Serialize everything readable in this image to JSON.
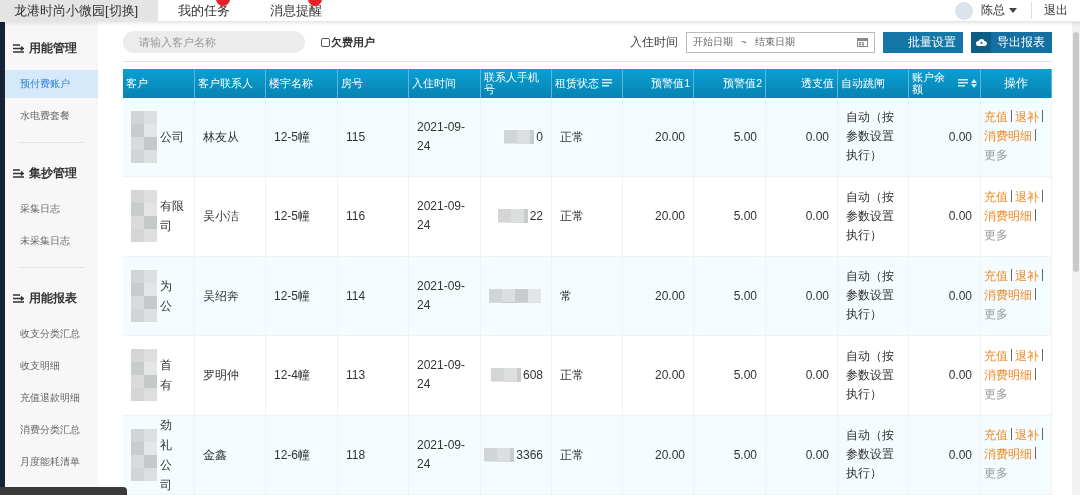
{
  "topbar": {
    "tabs": [
      {
        "label": "龙港时尚小微园[切换]",
        "selected": true,
        "badge": false
      },
      {
        "label": "我的任务",
        "selected": false,
        "badge": true
      },
      {
        "label": "消息提醒",
        "selected": false,
        "badge": true
      }
    ],
    "user": "陈总",
    "logout": "退出"
  },
  "sidebar": [
    {
      "title": "用能管理",
      "items": [
        {
          "label": "预付费账户",
          "selected": true
        },
        {
          "label": "水电费套餐",
          "selected": false
        }
      ]
    },
    {
      "title": "集抄管理",
      "items": [
        {
          "label": "采集日志",
          "selected": false
        },
        {
          "label": "未采集日志",
          "selected": false
        }
      ]
    },
    {
      "title": "用能报表",
      "items": [
        {
          "label": "收支分类汇总",
          "selected": false
        },
        {
          "label": "收支明细",
          "selected": false
        },
        {
          "label": "充值退款明细",
          "selected": false
        },
        {
          "label": "消费分类汇总",
          "selected": false
        },
        {
          "label": "月度能耗清单",
          "selected": false
        }
      ]
    }
  ],
  "filters": {
    "search": {
      "placeholder": "请输入客户名称"
    },
    "arrears": {
      "label": "欠费用户",
      "checked": false
    },
    "date_label": "入住时间",
    "date_start": "开始日期",
    "date_sep": "~",
    "date_end": "结束日期",
    "buttons": [
      {
        "label": "批量设置",
        "kind": "plain"
      },
      {
        "label": "导出报表",
        "kind": "export"
      }
    ]
  },
  "table": {
    "columns": [
      {
        "label": "客户",
        "sort": false
      },
      {
        "label": "客户联系人",
        "sort": false
      },
      {
        "label": "楼宇名称",
        "sort": false
      },
      {
        "label": "房号",
        "sort": false
      },
      {
        "label": "入住时间",
        "sort": false
      },
      {
        "label": "联系人手机号",
        "sort": false
      },
      {
        "label": "租赁状态",
        "sort": true
      },
      {
        "label": "预警值1",
        "sort": false
      },
      {
        "label": "预警值2",
        "sort": false
      },
      {
        "label": "透支值",
        "sort": false
      },
      {
        "label": "自动跳闸",
        "sort": false
      },
      {
        "label": "账户余额",
        "sort": true
      },
      {
        "label": "操作",
        "sort": false
      }
    ],
    "rows": [
      {
        "customer": [
          "公司"
        ],
        "contact": "林友从",
        "building": "12-5幢",
        "room": "115",
        "date": "2021-09-24",
        "phone": "0",
        "status": "正常",
        "warn1": "20.00",
        "warn2": "5.00",
        "overdraft": "0.00",
        "trip": "自动（按参数设置执行）",
        "balance": "0.00",
        "actions": [
          {
            "label": "充值",
            "kind": "link"
          },
          {
            "label": "退补",
            "kind": "link"
          },
          {
            "label": "消费明细",
            "kind": "link"
          },
          {
            "label": "更多",
            "kind": "more"
          }
        ]
      },
      {
        "customer": [
          "有限",
          "司"
        ],
        "contact": "吴小洁",
        "building": "12-5幢",
        "room": "116",
        "date": "2021-09-24",
        "phone": "22",
        "status": "正常",
        "warn1": "20.00",
        "warn2": "5.00",
        "overdraft": "0.00",
        "trip": "自动（按参数设置执行）",
        "balance": "0.00",
        "actions": [
          {
            "label": "充值",
            "kind": "link"
          },
          {
            "label": "退补",
            "kind": "link"
          },
          {
            "label": "消费明细",
            "kind": "link"
          },
          {
            "label": "更多",
            "kind": "more"
          }
        ]
      },
      {
        "customer": [
          "为",
          "公"
        ],
        "contact": "吴绍奔",
        "building": "12-5幢",
        "room": "114",
        "date": "2021-09-24",
        "phone": "",
        "status": "常",
        "warn1": "20.00",
        "warn2": "5.00",
        "overdraft": "0.00",
        "trip": "自动（按参数设置执行）",
        "balance": "0.00",
        "actions": [
          {
            "label": "充值",
            "kind": "link"
          },
          {
            "label": "退补",
            "kind": "link"
          },
          {
            "label": "消费明细",
            "kind": "link"
          },
          {
            "label": "更多",
            "kind": "more"
          }
        ]
      },
      {
        "customer": [
          "首",
          "有"
        ],
        "contact": "罗明仲",
        "building": "12-4幢",
        "room": "113",
        "date": "2021-09-24",
        "phone": "608",
        "status": "正常",
        "warn1": "20.00",
        "warn2": "5.00",
        "overdraft": "0.00",
        "trip": "自动（按参数设置执行）",
        "balance": "0.00",
        "actions": [
          {
            "label": "充值",
            "kind": "link"
          },
          {
            "label": "退补",
            "kind": "link"
          },
          {
            "label": "消费明细",
            "kind": "link"
          },
          {
            "label": "更多",
            "kind": "more"
          }
        ]
      },
      {
        "customer": [
          "劲",
          "礼",
          "公",
          "司"
        ],
        "contact": "金鑫",
        "building": "12-6幢",
        "room": "118",
        "date": "2021-09-24",
        "phone": "3366",
        "status": "正常",
        "warn1": "20.00",
        "warn2": "5.00",
        "overdraft": "0.00",
        "trip": "自动（按参数设置执行）",
        "balance": "0.00",
        "actions": [
          {
            "label": "充值",
            "kind": "link"
          },
          {
            "label": "退补",
            "kind": "link"
          },
          {
            "label": "消费明细",
            "kind": "link"
          },
          {
            "label": "更多",
            "kind": "more"
          }
        ]
      }
    ]
  }
}
